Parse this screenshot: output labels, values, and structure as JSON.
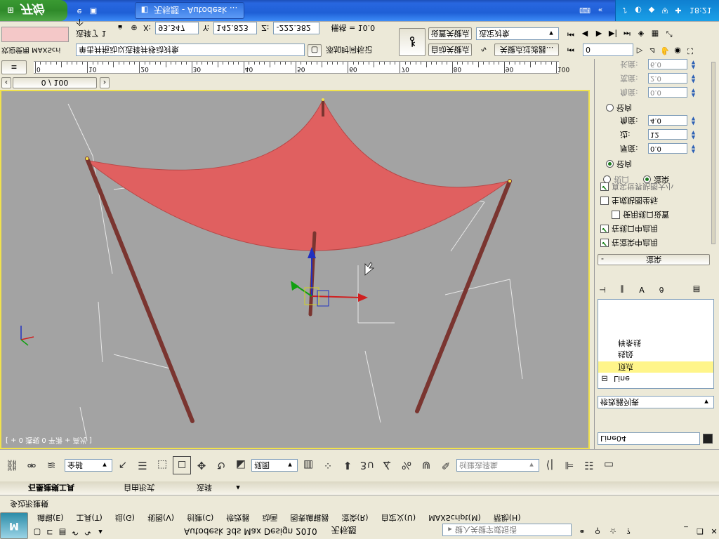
{
  "taskbar": {
    "start_label": "开始",
    "window_title": "无标题 - Autodesk ...",
    "clock": "18:21"
  },
  "status": {
    "maxscript_label": "欢迎使用 MAXScri",
    "selected": "选择了 1 个",
    "hint": "单击并拖动以选择并移动对象",
    "x_label": "X:",
    "x_value": "93.347",
    "y_label": "Y:",
    "y_value": "142.823",
    "z_label": "Z:",
    "z_value": "-222.382",
    "grid": "栅格 = 10.0",
    "add_time_tag": "添加时间标记",
    "auto_key": "自动关键点",
    "set_key": "设置关键点",
    "selected_set": "选定对象",
    "key_filters": "关键点过滤器...",
    "frame": "0"
  },
  "timeline": {
    "counter": "0 / 100",
    "ticks": [
      "0",
      "10",
      "20",
      "30",
      "40",
      "50",
      "60",
      "70",
      "80",
      "90",
      "100"
    ]
  },
  "viewport": {
    "label": "[ + 0 透视 0 平滑 + 高光 ]",
    "cursor_icon": "arrow-cursor-icon"
  },
  "right_panel": {
    "fields": [
      {
        "label": "角度:",
        "value": "0.0"
      },
      {
        "label": "宽度:",
        "value": "2.0"
      },
      {
        "label": "长度:",
        "value": "6.0"
      }
    ],
    "radial_label": "径向",
    "radial_fields": [
      {
        "label": "厚度:",
        "value": "0.0"
      },
      {
        "label": "边:",
        "value": "12"
      },
      {
        "label": "角度:",
        "value": "4.0"
      }
    ],
    "radial2_label": "径向",
    "viewport_radio": "视口",
    "render_radio": "渲染",
    "checks": [
      "真实世界贴图大小",
      "生成贴图坐标",
      "使用视口设置",
      "在视口中启用",
      "在渲染中启用"
    ],
    "rollout_title": "渲染",
    "stack_items": [
      "顶点",
      "线段",
      "样条线",
      "Line"
    ],
    "modifier_list": "修改器列表",
    "object_name": "Line04",
    "color_swatch": "#202020"
  },
  "main_toolbar": {
    "selection_filter": "全部",
    "ref_coord": "视图",
    "named_sel": "创建选择集"
  },
  "menus": {
    "items": [
      "编辑(E)",
      "工具(T)",
      "组(G)",
      "视图(V)",
      "创建(C)",
      "修改器",
      "动画",
      "图表编辑器",
      "渲染(R)",
      "自定义(U)",
      "MAXScript(M)",
      "帮助(H)"
    ],
    "app_title": "Autodesk 3ds Max Design 2010",
    "doc_title": "无标题",
    "search_placeholder": "键入关键字或短语"
  },
  "ribbon": {
    "tabs": [
      "石墨建模工具",
      "自由形式",
      "选择"
    ],
    "subtitle": "多边形建模"
  },
  "colors": {
    "viewport_bg": "#a3a3a3",
    "viewport_border": "#f1e24c",
    "mesh": "#e06060",
    "pole": "#7a3530",
    "highlight_row": "#fff58a"
  }
}
